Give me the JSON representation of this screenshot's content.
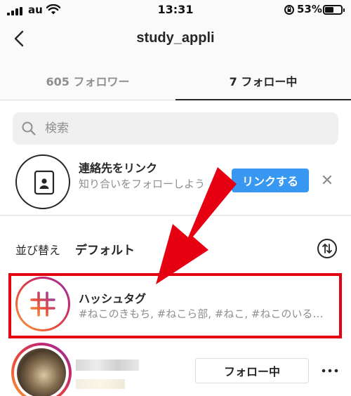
{
  "status_bar": {
    "carrier": "au",
    "time": "13:31",
    "battery": "53%",
    "battery_level": 0.53
  },
  "header": {
    "title": "study_appli"
  },
  "tabs": [
    {
      "label": "605 フォロワー",
      "active": false
    },
    {
      "label": "7 フォロー中",
      "active": true
    }
  ],
  "search": {
    "placeholder": "検索"
  },
  "contacts": {
    "title": "連絡先をリンク",
    "subtitle": "知り合いをフォローしよう",
    "button_label": "リンクする"
  },
  "sort": {
    "label": "並び替え",
    "value": "デフォルト"
  },
  "hashtags": {
    "title": "ハッシュタグ",
    "subtitle": "#ねこのきもち, #ねこら部, #ねこ, #ねこのいる生活"
  },
  "user": {
    "follow_label": "フォロー中"
  },
  "colors": {
    "primary_blue": "#3897f0",
    "text": "#262626",
    "muted": "#8e8e8e",
    "annotation_red": "#e60012"
  },
  "icons": {
    "back": "chevron-left-icon",
    "search": "search-icon",
    "contacts": "contact-book-icon",
    "dismiss": "close-icon",
    "sort": "sort-arrows-icon",
    "hashtag": "hashtag-icon",
    "more": "ellipsis-icon"
  }
}
